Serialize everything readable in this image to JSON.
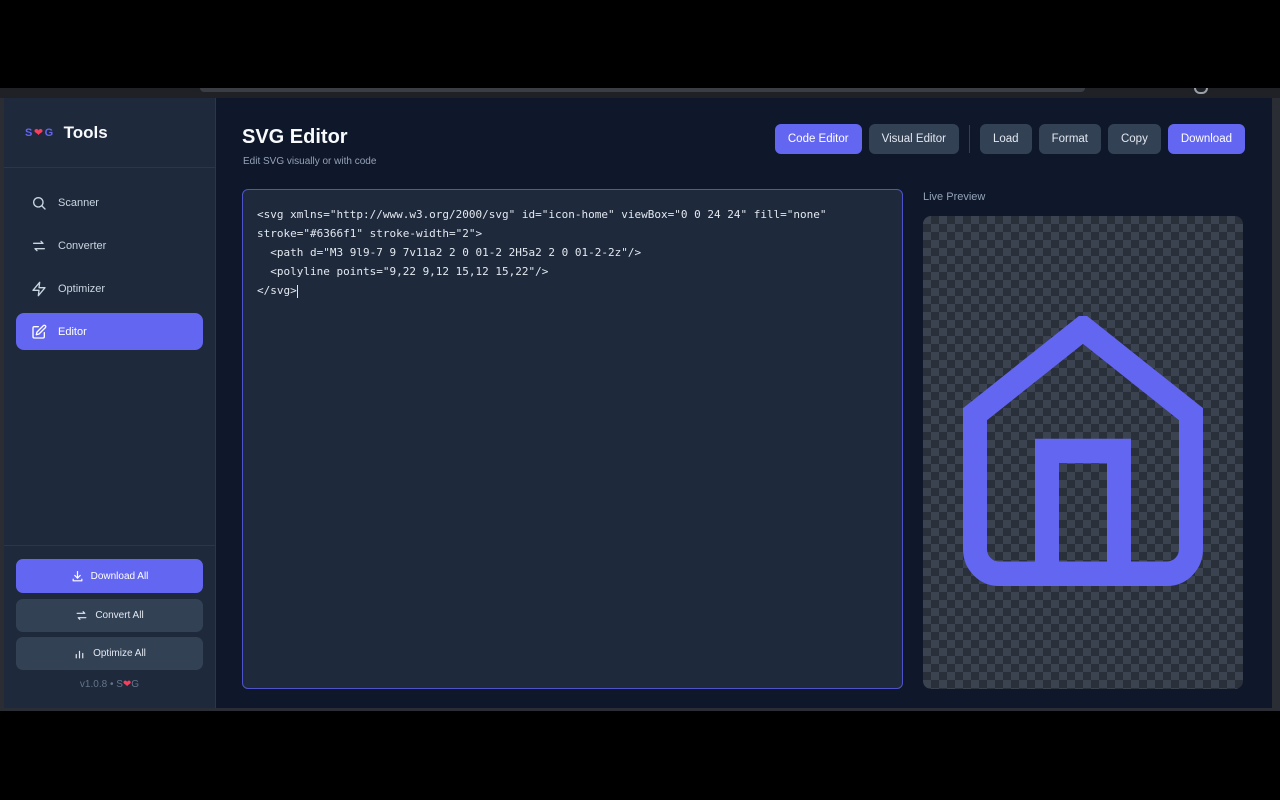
{
  "brand": {
    "logo_s": "S",
    "logo_g": "G",
    "title": "Tools"
  },
  "nav": {
    "items": [
      {
        "label": "Scanner",
        "icon": "search-icon",
        "active": false
      },
      {
        "label": "Converter",
        "icon": "convert-icon",
        "active": false
      },
      {
        "label": "Optimizer",
        "icon": "lightning-icon",
        "active": false
      },
      {
        "label": "Editor",
        "icon": "edit-icon",
        "active": true
      }
    ]
  },
  "sidebar_actions": {
    "download_all": "Download All",
    "convert_all": "Convert All",
    "optimize_all": "Optimize All"
  },
  "version": {
    "text": "v1.0.8 • S",
    "suffix": "G"
  },
  "page": {
    "title": "SVG Editor",
    "subtitle": "Edit SVG visually or with code"
  },
  "toolbar": {
    "code_editor": "Code Editor",
    "visual_editor": "Visual Editor",
    "load": "Load",
    "format": "Format",
    "copy": "Copy",
    "download": "Download"
  },
  "code": {
    "lines": [
      "<svg xmlns=\"http://www.w3.org/2000/svg\" id=\"icon-home\" viewBox=\"0 0 24 24\" fill=\"none\"",
      "stroke=\"#6366f1\" stroke-width=\"2\">",
      "  <path d=\"M3 9l9-7 9 7v11a2 2 0 01-2 2H5a2 2 0 01-2-2z\"/>",
      "  <polyline points=\"9,22 9,12 15,12 15,22\"/>",
      "</svg>"
    ]
  },
  "preview": {
    "label": "Live Preview",
    "stroke_color": "#6366f1"
  },
  "colors": {
    "accent": "#6366f1",
    "heart": "#f43f5e",
    "background": "#0f172a",
    "panel": "#1e293b"
  }
}
